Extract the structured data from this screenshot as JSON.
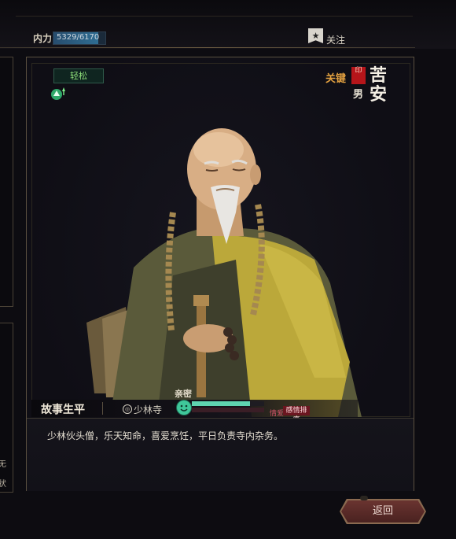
{
  "top_bar": {
    "neili_label": "内力",
    "neili_value": "5329/6170",
    "neili_fraction": 0.864,
    "follow_label": "关注",
    "follow_icon": "star-bookmark-icon"
  },
  "left_panel": {
    "glyph_1": "无",
    "glyph_2": "状"
  },
  "character": {
    "mood": "轻松",
    "mood_icon": "mood-up-arrow-icon",
    "key_label": "关键",
    "seal_text": "印",
    "gender": "男",
    "name": "苦安"
  },
  "story": {
    "title": "故事生平",
    "sect": "少林寺",
    "sect_icon": "sect-circle-icon",
    "intimacy_label": "亲密",
    "intimacy_fraction": 0.8,
    "feeling_label": "情爱",
    "feeling_rank": "感情排序"
  },
  "description": "少林伙头僧，乐天知命，喜爱烹饪，平日负责寺内杂务。",
  "buttons": {
    "return_label": "返回"
  },
  "colors": {
    "accent_gold": "#e2a040",
    "mood_green": "#8fe07a",
    "intimacy_teal": "#5fd4b0",
    "seal_red": "#b5151a"
  }
}
